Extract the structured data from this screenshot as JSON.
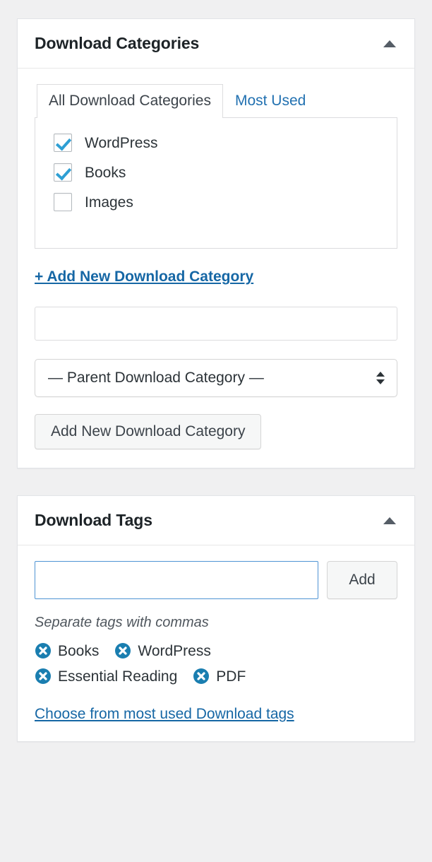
{
  "panels": {
    "categories": {
      "title": "Download Categories",
      "toggle_icon": "triangle-up-icon",
      "tabs": [
        {
          "label": "All Download Categories",
          "active": true
        },
        {
          "label": "Most Used",
          "active": false
        }
      ],
      "items": [
        {
          "label": "WordPress",
          "checked": true
        },
        {
          "label": "Books",
          "checked": true
        },
        {
          "label": "Images",
          "checked": false
        }
      ],
      "add_new_link": "+ Add New Download Category",
      "new_category_input": {
        "value": "",
        "placeholder": ""
      },
      "parent_select": {
        "selected": "— Parent Download Category —",
        "icon": "updown-arrows-icon"
      },
      "submit_button": "Add New Download Category"
    },
    "tags": {
      "title": "Download Tags",
      "toggle_icon": "triangle-up-icon",
      "input": {
        "value": "",
        "placeholder": ""
      },
      "add_button": "Add",
      "hint": "Separate tags with commas",
      "tags": [
        {
          "label": "Books",
          "remove_icon": "circle-x-icon"
        },
        {
          "label": "WordPress",
          "remove_icon": "circle-x-icon"
        },
        {
          "label": "Essential Reading",
          "remove_icon": "circle-x-icon"
        },
        {
          "label": "PDF",
          "remove_icon": "circle-x-icon"
        }
      ],
      "most_used_link": "Choose from most used Download tags"
    }
  },
  "colors": {
    "page_background": "#f0f0f1",
    "panel_background": "#ffffff",
    "panel_border": "#e2e4e7",
    "link_blue": "#1667a5",
    "tab_link_blue": "#2271b1",
    "checkbox_check": "#2e9fd4",
    "tag_remove_icon": "#1a7eb0",
    "heading_text": "#1d2327",
    "body_text": "#2c3338",
    "focus_border": "#4f94d4"
  }
}
